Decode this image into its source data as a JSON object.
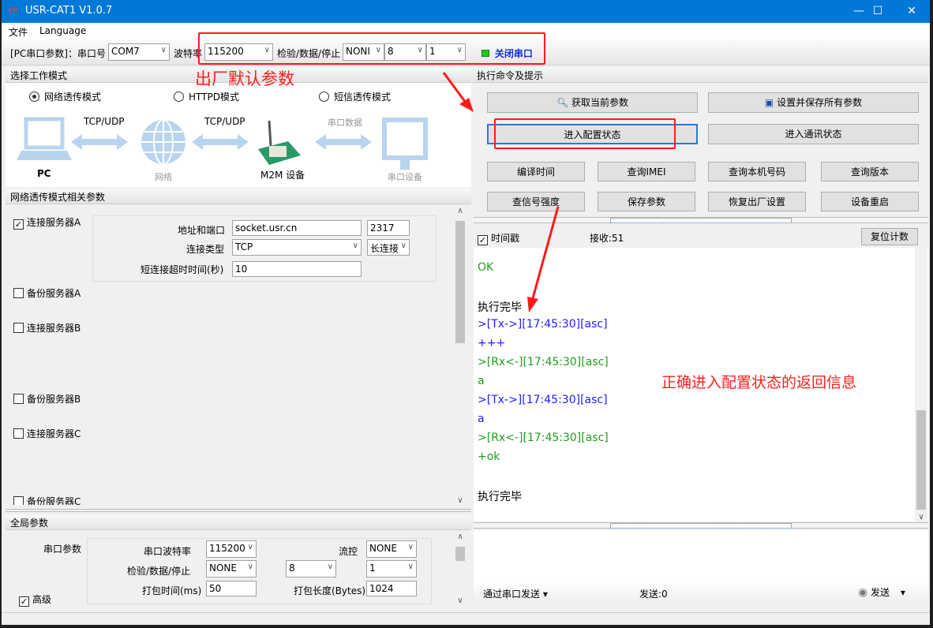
{
  "window": {
    "title": "USR-CAT1 V1.0.7",
    "minimize": "—",
    "maximize": "☐",
    "close": "✕"
  },
  "menu": [
    "文件",
    "Language"
  ],
  "toolbar": {
    "pc_params": "[PC串口参数]：串口号",
    "port": "COM7",
    "baud_label": "波特率",
    "baud": "115200",
    "parity_label": "检验/数据/停止",
    "parity": "NONI",
    "data_bits": "8",
    "stop_bits": "1",
    "close_port": "关闭串口",
    "led_color": "#1ec81e"
  },
  "annotations": {
    "factory": "出厂默认参数",
    "correct": "正确进入配置状态的返回信息",
    "color": "#ff1a1a"
  },
  "mode": {
    "header": "选择工作模式",
    "options": [
      "网络透传模式",
      "HTTPD模式",
      "短信透传模式"
    ],
    "selected": 0,
    "diagram": {
      "pc": "PC",
      "link1": "TCP/UDP",
      "net": "网络",
      "link2": "TCP/UDP",
      "m2m": "M2M 设备",
      "link3": "串口数据",
      "serial": "串口设备"
    }
  },
  "net_params": {
    "header": "网络透传模式相关参数",
    "serverA": {
      "label": "连接服务器A",
      "checked": true,
      "addr_label": "地址和端口",
      "addr": "socket.usr.cn",
      "port": "2317",
      "type_label": "连接类型",
      "type": "TCP",
      "conn": "长连接",
      "timeout_label": "短连接超时时间(秒)",
      "timeout": "10"
    },
    "others": [
      {
        "label": "备份服务器A",
        "checked": false
      },
      {
        "label": "连接服务器B",
        "checked": false
      },
      {
        "label": "备份服务器B",
        "checked": false
      },
      {
        "label": "连接服务器C",
        "checked": false
      },
      {
        "label": "备份服务器C",
        "checked": false
      }
    ]
  },
  "global": {
    "header": "全局参数",
    "serial_label": "串口参数",
    "baud_label": "串口波特率",
    "baud": "115200",
    "flow_label": "流控",
    "flow": "NONE",
    "parity_label": "检验/数据/停止",
    "parity": "NONE",
    "data_bits": "8",
    "stop_bits": "1",
    "pack_time_label": "打包时间(ms)",
    "pack_time": "50",
    "pack_len_label": "打包长度(Bytes)",
    "pack_len": "1024",
    "advanced": "高级",
    "advanced_checked": true
  },
  "commands": {
    "header": "执行命令及提示",
    "get_params": "获取当前参数",
    "save_all": "设置并保存所有参数",
    "enter_config": "进入配置状态",
    "enter_comm": "进入通讯状态",
    "row3": [
      "编译时间",
      "查询IMEI",
      "查询本机号码",
      "查询版本"
    ],
    "row4": [
      "查信号强度",
      "保存参数",
      "恢复出厂设置",
      "设备重启"
    ]
  },
  "log": {
    "timestamp_label": "时间戳",
    "timestamp_checked": true,
    "recv": "接收:51",
    "reset": "复位计数",
    "lines": [
      {
        "t": "OK",
        "c": "#1f9e1f"
      },
      {
        "t": "",
        "c": "#000"
      },
      {
        "t": "执行完毕",
        "c": "#000"
      },
      {
        "t": ">[Tx->][17:45:30][asc]",
        "c": "#2020ff"
      },
      {
        "t": "+++",
        "c": "#2020ff"
      },
      {
        "t": ">[Rx<-][17:45:30][asc]",
        "c": "#1f9e1f"
      },
      {
        "t": "a",
        "c": "#1f9e1f"
      },
      {
        "t": ">[Tx->][17:45:30][asc]",
        "c": "#2020ff"
      },
      {
        "t": "a",
        "c": "#2020ff"
      },
      {
        "t": ">[Rx<-][17:45:30][asc]",
        "c": "#1f9e1f"
      },
      {
        "t": "+ok",
        "c": "#1f9e1f"
      },
      {
        "t": "",
        "c": "#000"
      },
      {
        "t": "执行完毕",
        "c": "#000"
      }
    ]
  },
  "send": {
    "mode": "通过串口发送",
    "sent": "发送:0",
    "send_btn": "发送"
  }
}
